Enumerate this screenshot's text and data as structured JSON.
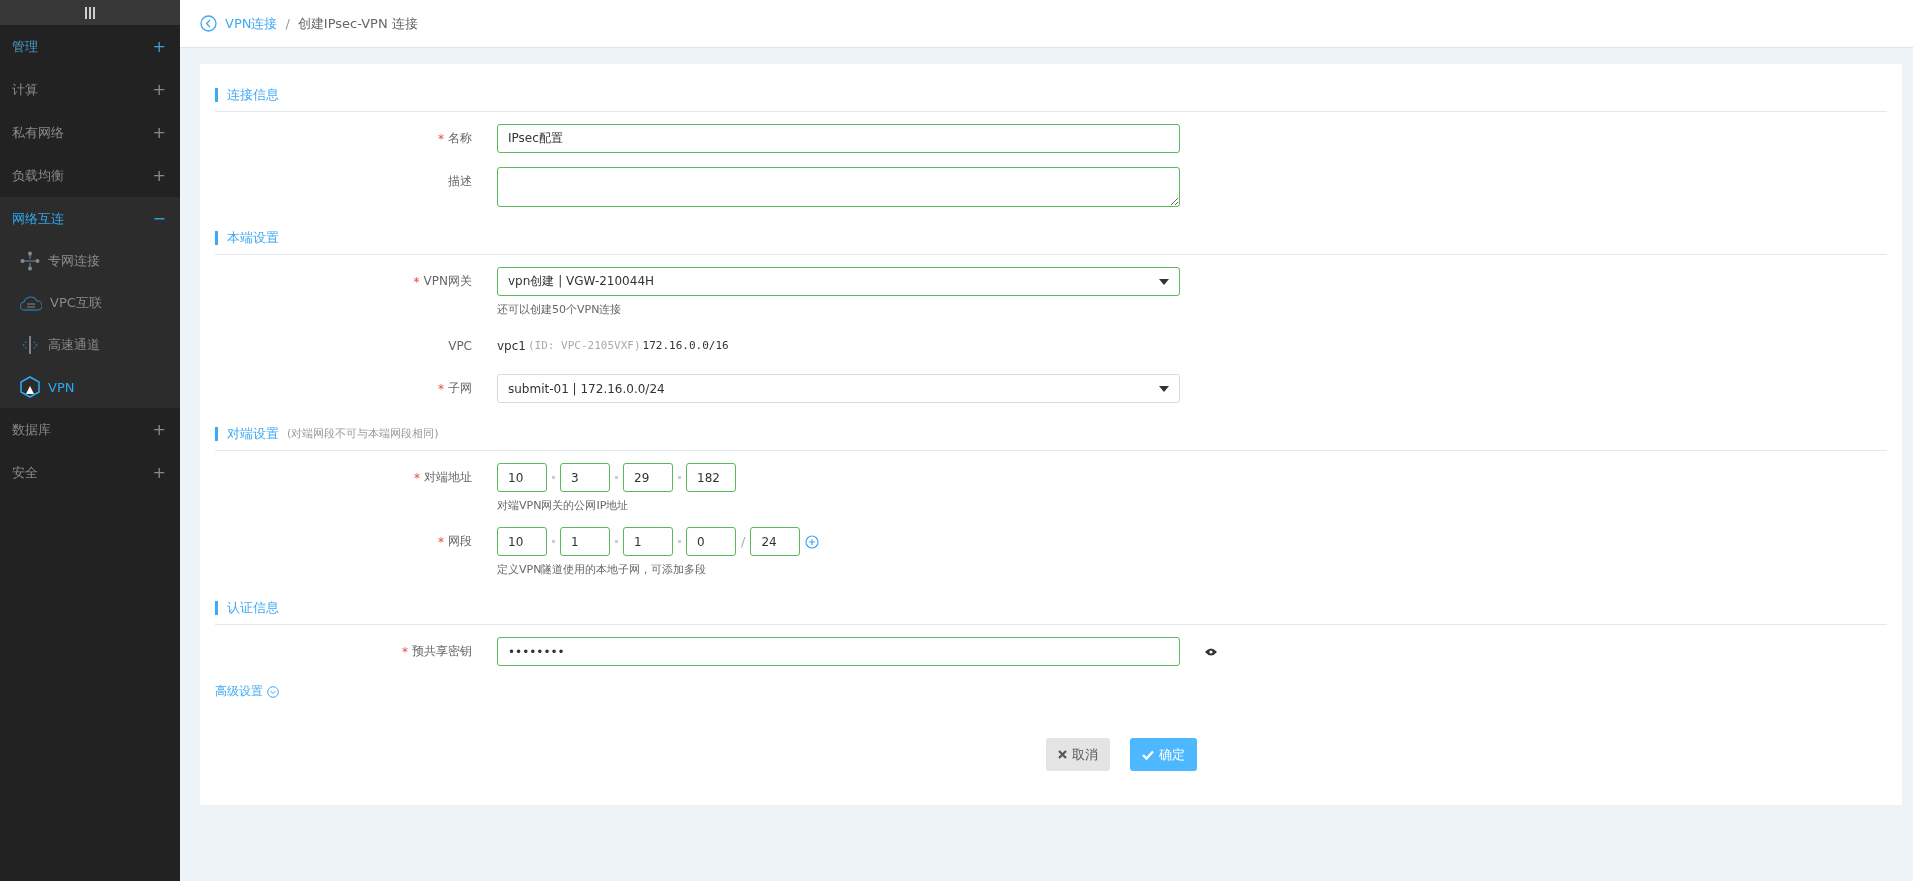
{
  "sidebar": {
    "groups": [
      {
        "label": "管理",
        "highlighted": true,
        "selected": false,
        "toggle": "+"
      },
      {
        "label": "计算",
        "highlighted": false,
        "selected": false,
        "toggle": "+"
      },
      {
        "label": "私有网络",
        "highlighted": false,
        "selected": false,
        "toggle": "+"
      },
      {
        "label": "负载均衡",
        "highlighted": false,
        "selected": false,
        "toggle": "+"
      },
      {
        "label": "网络互连",
        "highlighted": false,
        "selected": true,
        "toggle": "−",
        "children": [
          {
            "label": "专网连接",
            "kind": "network",
            "selected": false
          },
          {
            "label": "VPC互联",
            "kind": "cloud",
            "selected": false
          },
          {
            "label": "高速通道",
            "kind": "channel",
            "selected": false
          },
          {
            "label": "VPN",
            "kind": "shield",
            "selected": true
          }
        ]
      },
      {
        "label": "数据库",
        "highlighted": false,
        "selected": false,
        "toggle": "+"
      },
      {
        "label": "安全",
        "highlighted": false,
        "selected": false,
        "toggle": "+"
      }
    ]
  },
  "breadcrumb": {
    "parent": "VPN连接",
    "separator": "/",
    "current": "创建IPsec-VPN 连接"
  },
  "sections": [
    {
      "title": "连接信息",
      "fields": [
        {
          "kind": "text",
          "label": "名称",
          "required": "*",
          "value": "IPsec配置"
        },
        {
          "kind": "textarea",
          "label": "描述"
        }
      ]
    },
    {
      "title": "本端设置",
      "fields": [
        {
          "kind": "select",
          "label": "VPN网关",
          "required": "*",
          "validated": true,
          "value": "vpn创建 | VGW-210044H",
          "hint": "还可以创建50个VPN连接"
        },
        {
          "kind": "static",
          "label": "VPC",
          "name": "vpc1",
          "id": "(ID: VPC-2105VXF)",
          "cidr": "172.16.0.0/16"
        },
        {
          "kind": "select",
          "label": "子网",
          "required": "*",
          "validated": false,
          "value": "submit-01 | 172.16.0.0/24"
        }
      ]
    },
    {
      "title": "对端设置",
      "note": "(对端网段不可与本端网段相同)",
      "fields": [
        {
          "kind": "ip",
          "label": "对端地址",
          "required": "*",
          "octets": [
            "10",
            "3",
            "29",
            "182"
          ],
          "hint": "对端VPN网关的公网IP地址"
        },
        {
          "kind": "cidr",
          "label": "网段",
          "required": "*",
          "octets": [
            "10",
            "1",
            "1",
            "0"
          ],
          "slash": "/",
          "prefix": "24",
          "hint": "定义VPN隧道使用的本地子网，可添加多段"
        }
      ]
    },
    {
      "title": "认证信息",
      "fields": [
        {
          "kind": "password",
          "label": "预共享密钥",
          "required": "*",
          "value": "••••••••"
        }
      ]
    }
  ],
  "advanced": {
    "label": "高级设置",
    "expanded": false
  },
  "buttons": [
    {
      "label": "取消",
      "kind": "cancel"
    },
    {
      "label": "确定",
      "kind": "confirm"
    }
  ]
}
